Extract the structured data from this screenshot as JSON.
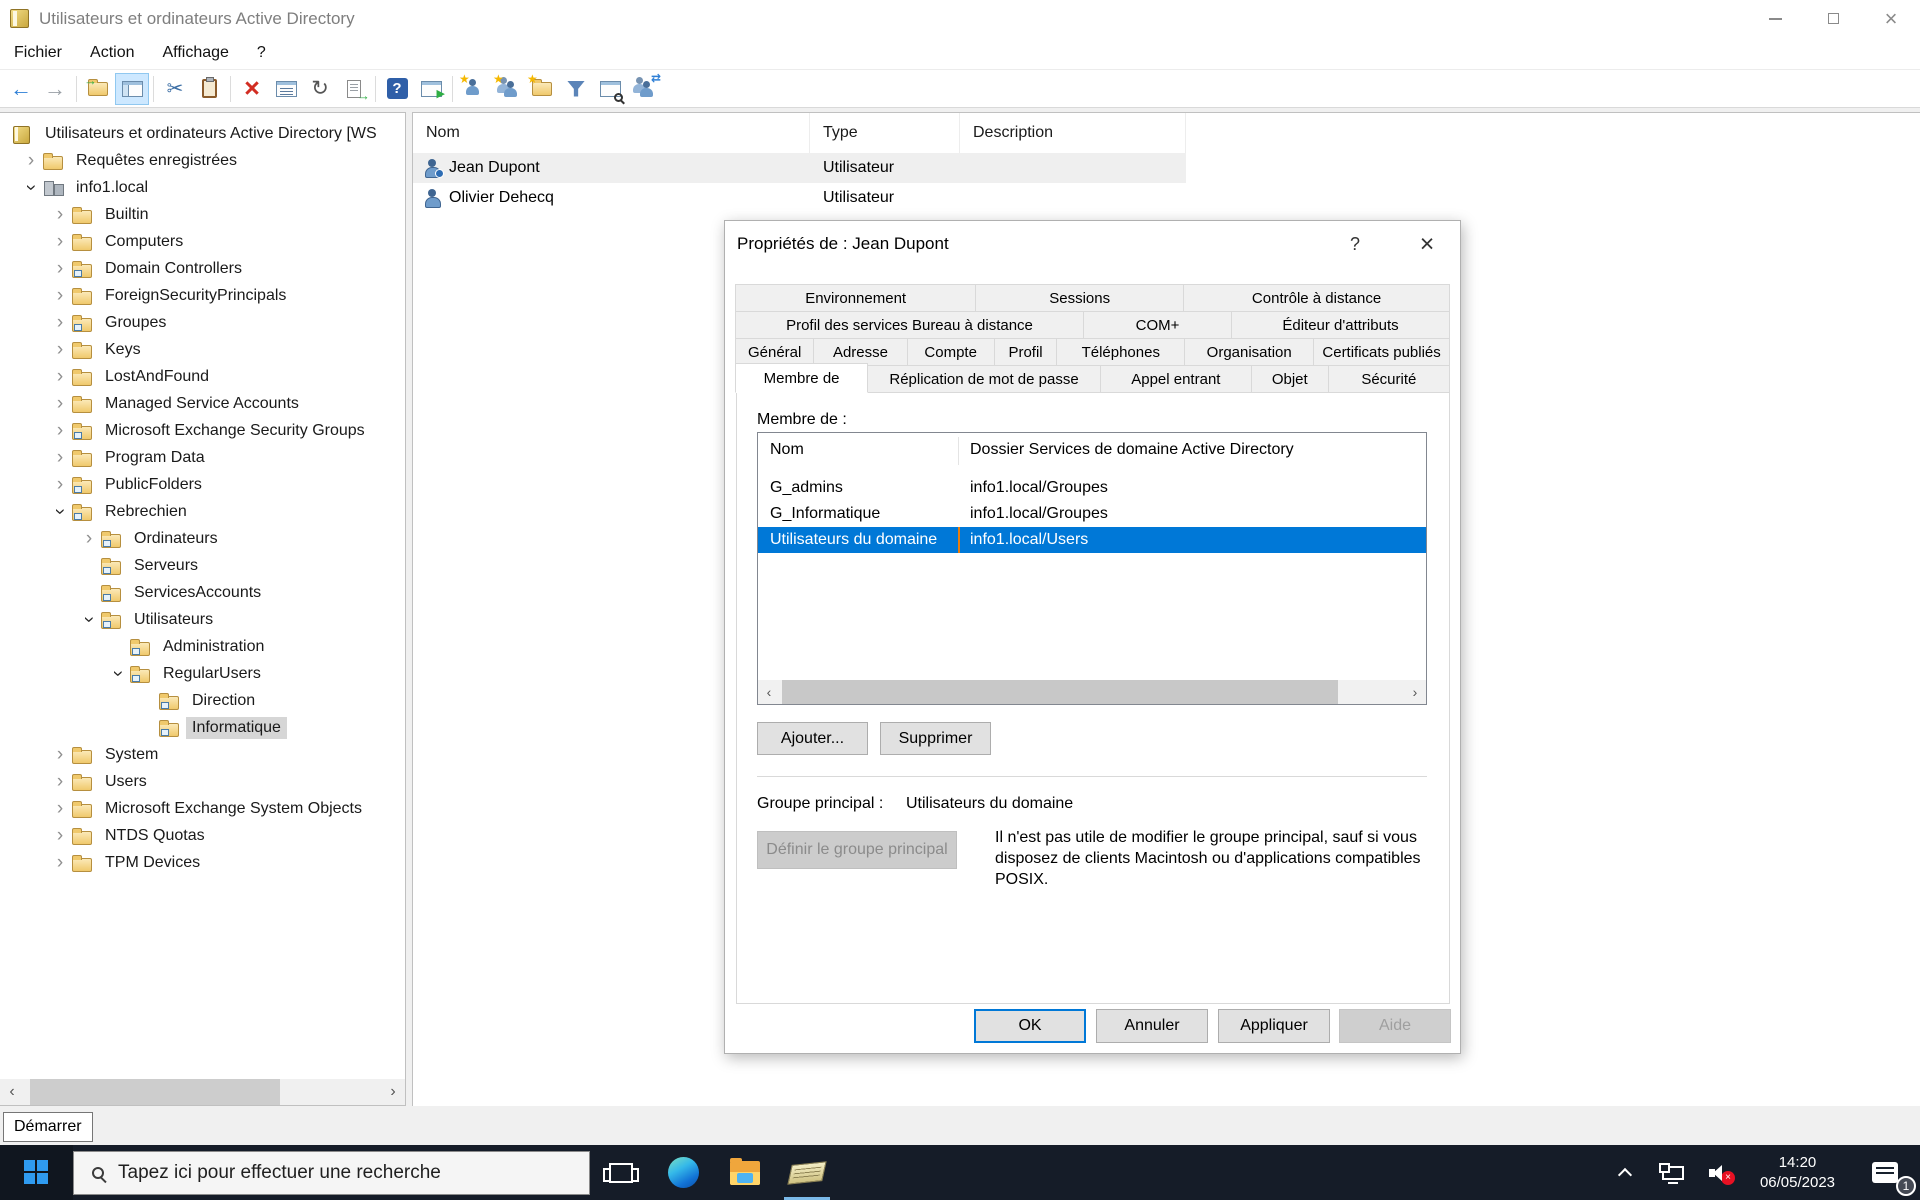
{
  "colors": {
    "accent": "#0078d7",
    "selection_blue": "#0078d7",
    "selected_divider_orange": "#e87d0d",
    "taskbar_bg": "#151c28"
  },
  "icons": {
    "chevron": "›",
    "scroll_left": "‹",
    "scroll_right": "›",
    "close_glyph": "×",
    "help_glyph": "?"
  },
  "window": {
    "title": "Utilisateurs et ordinateurs Active Directory"
  },
  "menu": {
    "items": [
      "Fichier",
      "Action",
      "Affichage",
      "?"
    ]
  },
  "toolbar": {
    "groups": [
      [
        "back",
        "forward"
      ],
      [
        "open-folder",
        "console-tree"
      ],
      [
        "cut",
        "paste"
      ],
      [
        "delete",
        "prop-list",
        "refresh",
        "export-list"
      ],
      [
        "help",
        "play-win"
      ],
      [
        "new-user",
        "new-group",
        "new-ou",
        "filter",
        "find",
        "delegate"
      ]
    ]
  },
  "tree": {
    "items": [
      {
        "label": "Utilisateurs et ordinateurs Active Directory [WS",
        "level": 0,
        "exp": "root",
        "icon": "console",
        "selected": false
      },
      {
        "label": "Requêtes enregistrées",
        "level": 1,
        "exp": "c",
        "icon": "folder",
        "selected": false
      },
      {
        "label": "info1.local",
        "level": 1,
        "exp": "e",
        "icon": "domain",
        "selected": false
      },
      {
        "label": "Builtin",
        "level": 2,
        "exp": "c",
        "icon": "folder",
        "selected": false
      },
      {
        "label": "Computers",
        "level": 2,
        "exp": "c",
        "icon": "folder",
        "selected": false
      },
      {
        "label": "Domain Controllers",
        "level": 2,
        "exp": "c",
        "icon": "ou",
        "selected": false
      },
      {
        "label": "ForeignSecurityPrincipals",
        "level": 2,
        "exp": "c",
        "icon": "folder",
        "selected": false
      },
      {
        "label": "Groupes",
        "level": 2,
        "exp": "c",
        "icon": "ou",
        "selected": false
      },
      {
        "label": "Keys",
        "level": 2,
        "exp": "c",
        "icon": "folder",
        "selected": false
      },
      {
        "label": "LostAndFound",
        "level": 2,
        "exp": "c",
        "icon": "folder",
        "selected": false
      },
      {
        "label": "Managed Service Accounts",
        "level": 2,
        "exp": "c",
        "icon": "folder",
        "selected": false
      },
      {
        "label": "Microsoft Exchange Security Groups",
        "level": 2,
        "exp": "c",
        "icon": "ou",
        "selected": false
      },
      {
        "label": "Program Data",
        "level": 2,
        "exp": "c",
        "icon": "folder",
        "selected": false
      },
      {
        "label": "PublicFolders",
        "level": 2,
        "exp": "c",
        "icon": "ou",
        "selected": false
      },
      {
        "label": "Rebrechien",
        "level": 2,
        "exp": "e",
        "icon": "ou",
        "selected": false
      },
      {
        "label": "Ordinateurs",
        "level": 3,
        "exp": "c",
        "icon": "ou",
        "selected": false
      },
      {
        "label": "Serveurs",
        "level": 3,
        "exp": "n",
        "icon": "ou",
        "selected": false
      },
      {
        "label": "ServicesAccounts",
        "level": 3,
        "exp": "n",
        "icon": "ou",
        "selected": false
      },
      {
        "label": "Utilisateurs",
        "level": 3,
        "exp": "e",
        "icon": "ou",
        "selected": false
      },
      {
        "label": "Administration",
        "level": 4,
        "exp": "n",
        "icon": "ou",
        "selected": false
      },
      {
        "label": "RegularUsers",
        "level": 4,
        "exp": "e",
        "icon": "ou",
        "selected": false
      },
      {
        "label": "Direction",
        "level": 5,
        "exp": "n",
        "icon": "ou",
        "selected": false
      },
      {
        "label": "Informatique",
        "level": 5,
        "exp": "n",
        "icon": "ou",
        "selected": true
      },
      {
        "label": "System",
        "level": 2,
        "exp": "c",
        "icon": "folder",
        "selected": false
      },
      {
        "label": "Users",
        "level": 2,
        "exp": "c",
        "icon": "folder",
        "selected": false
      },
      {
        "label": "Microsoft Exchange System Objects",
        "level": 2,
        "exp": "c",
        "icon": "folder",
        "selected": false
      },
      {
        "label": "NTDS Quotas",
        "level": 2,
        "exp": "c",
        "icon": "folder",
        "selected": false
      },
      {
        "label": "TPM Devices",
        "level": 2,
        "exp": "c",
        "icon": "folder",
        "selected": false
      }
    ]
  },
  "list": {
    "columns": [
      "Nom",
      "Type",
      "Description"
    ],
    "rows": [
      {
        "name": "Jean Dupont",
        "type": "Utilisateur",
        "description": "",
        "selected": true,
        "badge": true
      },
      {
        "name": "Olivier Dehecq",
        "type": "Utilisateur",
        "description": "",
        "selected": false,
        "badge": false
      }
    ]
  },
  "dialog": {
    "title": "Propriétés de : Jean Dupont",
    "tab_rows": [
      [
        {
          "label": "Environnement",
          "flex": 243
        },
        {
          "label": "Sessions",
          "flex": 210
        },
        {
          "label": "Contrôle à distance",
          "flex": 269
        }
      ],
      [
        {
          "label": "Profil des services Bureau à distance",
          "flex": 347
        },
        {
          "label": "COM+",
          "flex": 147
        },
        {
          "label": "Éditeur d'attributs",
          "flex": 217
        }
      ],
      [
        {
          "label": "Général",
          "flex": 78
        },
        {
          "label": "Adresse",
          "flex": 93
        },
        {
          "label": "Compte",
          "flex": 87
        },
        {
          "label": "Profil",
          "flex": 62
        },
        {
          "label": "Téléphones",
          "flex": 128
        },
        {
          "label": "Organisation",
          "flex": 129
        },
        {
          "label": "Certificats publiés",
          "flex": 136
        }
      ],
      [
        {
          "label": "Membre de",
          "flex": 133,
          "active": true
        },
        {
          "label": "Réplication de mot de passe",
          "flex": 235
        },
        {
          "label": "Appel entrant",
          "flex": 152
        },
        {
          "label": "Objet",
          "flex": 77
        },
        {
          "label": "Sécurité",
          "flex": 122
        }
      ]
    ],
    "section_label": "Membre de :",
    "members": {
      "columns": [
        "Nom",
        "Dossier Services de domaine Active Directory"
      ],
      "rows": [
        {
          "name": "G_admins",
          "folder": "info1.local/Groupes",
          "selected": false
        },
        {
          "name": "G_Informatique",
          "folder": "info1.local/Groupes",
          "selected": false
        },
        {
          "name": "Utilisateurs du domaine",
          "folder": "info1.local/Users",
          "selected": true
        }
      ]
    },
    "add_button": "Ajouter...",
    "remove_button": "Supprimer",
    "primary_group_label": "Groupe principal :",
    "primary_group_value": "Utilisateurs du domaine",
    "set_primary_button": "Définir le groupe principal",
    "primary_group_note": "Il n'est pas utile de modifier le groupe principal, sauf si vous disposez de clients Macintosh ou d'applications compatibles POSIX.",
    "footer": {
      "ok": "OK",
      "cancel": "Annuler",
      "apply": "Appliquer",
      "help": "Aide"
    }
  },
  "start_tooltip": "Démarrer",
  "taskbar": {
    "search_placeholder": "Tapez ici pour effectuer une recherche",
    "clock_time": "14:20",
    "clock_date": "06/05/2023",
    "notification_count": "1"
  }
}
